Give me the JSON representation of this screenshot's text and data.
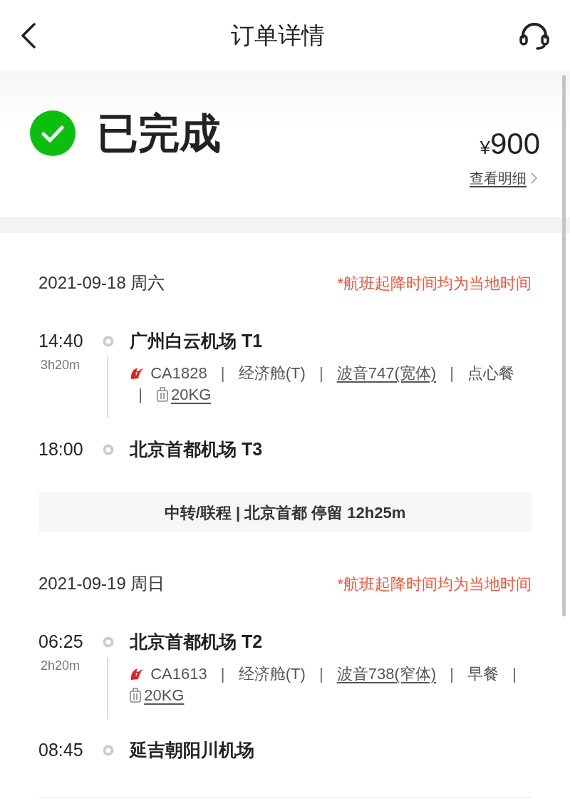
{
  "header": {
    "title": "订单详情"
  },
  "status": {
    "text": "已完成",
    "currency": "¥",
    "price": "900",
    "detail_link": "查看明细"
  },
  "itinerary": [
    {
      "kind": "leg",
      "date": "2021-09-18 周六",
      "note": "*航班起降时间均为当地时间",
      "departure": {
        "time": "14:40",
        "airport": "广州白云机场 T1"
      },
      "duration": "3h20m",
      "separator": "|",
      "details": [
        {
          "text": "CA1828",
          "kind": "flight"
        },
        {
          "text": "经济舱(T)",
          "kind": "plain"
        },
        {
          "text": "波音747(宽体)",
          "kind": "link"
        },
        {
          "text": "点心餐",
          "kind": "plain"
        },
        {
          "text": "20KG",
          "kind": "baggage"
        }
      ],
      "arrival": {
        "time": "18:00",
        "airport": "北京首都机场 T3"
      }
    },
    {
      "kind": "transfer",
      "text": "中转/联程 | 北京首都 停留 12h25m"
    },
    {
      "kind": "leg",
      "date": "2021-09-19 周日",
      "note": "*航班起降时间均为当地时间",
      "departure": {
        "time": "06:25",
        "airport": "北京首都机场 T2"
      },
      "duration": "2h20m",
      "separator": "|",
      "details": [
        {
          "text": "CA1613",
          "kind": "flight"
        },
        {
          "text": "经济舱(T)",
          "kind": "plain"
        },
        {
          "text": "波音738(窄体)",
          "kind": "link"
        },
        {
          "text": "早餐",
          "kind": "plain"
        },
        {
          "text": "20KG",
          "kind": "baggage"
        }
      ],
      "arrival": {
        "time": "08:45",
        "airport": "延吉朝阳川机场"
      }
    }
  ]
}
